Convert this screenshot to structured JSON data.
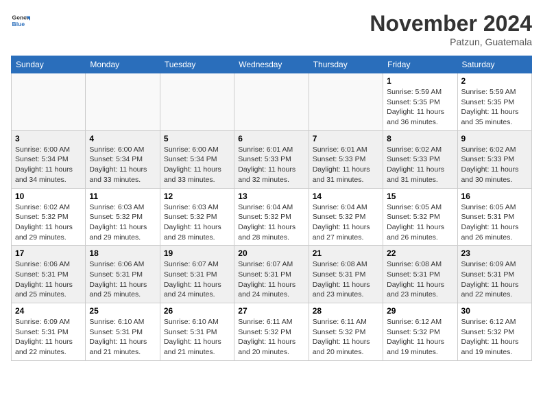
{
  "header": {
    "logo_general": "General",
    "logo_blue": "Blue",
    "month_title": "November 2024",
    "location": "Patzun, Guatemala"
  },
  "weekdays": [
    "Sunday",
    "Monday",
    "Tuesday",
    "Wednesday",
    "Thursday",
    "Friday",
    "Saturday"
  ],
  "weeks": [
    [
      {
        "day": "",
        "info": ""
      },
      {
        "day": "",
        "info": ""
      },
      {
        "day": "",
        "info": ""
      },
      {
        "day": "",
        "info": ""
      },
      {
        "day": "",
        "info": ""
      },
      {
        "day": "1",
        "info": "Sunrise: 5:59 AM\nSunset: 5:35 PM\nDaylight: 11 hours\nand 36 minutes."
      },
      {
        "day": "2",
        "info": "Sunrise: 5:59 AM\nSunset: 5:35 PM\nDaylight: 11 hours\nand 35 minutes."
      }
    ],
    [
      {
        "day": "3",
        "info": "Sunrise: 6:00 AM\nSunset: 5:34 PM\nDaylight: 11 hours\nand 34 minutes."
      },
      {
        "day": "4",
        "info": "Sunrise: 6:00 AM\nSunset: 5:34 PM\nDaylight: 11 hours\nand 33 minutes."
      },
      {
        "day": "5",
        "info": "Sunrise: 6:00 AM\nSunset: 5:34 PM\nDaylight: 11 hours\nand 33 minutes."
      },
      {
        "day": "6",
        "info": "Sunrise: 6:01 AM\nSunset: 5:33 PM\nDaylight: 11 hours\nand 32 minutes."
      },
      {
        "day": "7",
        "info": "Sunrise: 6:01 AM\nSunset: 5:33 PM\nDaylight: 11 hours\nand 31 minutes."
      },
      {
        "day": "8",
        "info": "Sunrise: 6:02 AM\nSunset: 5:33 PM\nDaylight: 11 hours\nand 31 minutes."
      },
      {
        "day": "9",
        "info": "Sunrise: 6:02 AM\nSunset: 5:33 PM\nDaylight: 11 hours\nand 30 minutes."
      }
    ],
    [
      {
        "day": "10",
        "info": "Sunrise: 6:02 AM\nSunset: 5:32 PM\nDaylight: 11 hours\nand 29 minutes."
      },
      {
        "day": "11",
        "info": "Sunrise: 6:03 AM\nSunset: 5:32 PM\nDaylight: 11 hours\nand 29 minutes."
      },
      {
        "day": "12",
        "info": "Sunrise: 6:03 AM\nSunset: 5:32 PM\nDaylight: 11 hours\nand 28 minutes."
      },
      {
        "day": "13",
        "info": "Sunrise: 6:04 AM\nSunset: 5:32 PM\nDaylight: 11 hours\nand 28 minutes."
      },
      {
        "day": "14",
        "info": "Sunrise: 6:04 AM\nSunset: 5:32 PM\nDaylight: 11 hours\nand 27 minutes."
      },
      {
        "day": "15",
        "info": "Sunrise: 6:05 AM\nSunset: 5:32 PM\nDaylight: 11 hours\nand 26 minutes."
      },
      {
        "day": "16",
        "info": "Sunrise: 6:05 AM\nSunset: 5:31 PM\nDaylight: 11 hours\nand 26 minutes."
      }
    ],
    [
      {
        "day": "17",
        "info": "Sunrise: 6:06 AM\nSunset: 5:31 PM\nDaylight: 11 hours\nand 25 minutes."
      },
      {
        "day": "18",
        "info": "Sunrise: 6:06 AM\nSunset: 5:31 PM\nDaylight: 11 hours\nand 25 minutes."
      },
      {
        "day": "19",
        "info": "Sunrise: 6:07 AM\nSunset: 5:31 PM\nDaylight: 11 hours\nand 24 minutes."
      },
      {
        "day": "20",
        "info": "Sunrise: 6:07 AM\nSunset: 5:31 PM\nDaylight: 11 hours\nand 24 minutes."
      },
      {
        "day": "21",
        "info": "Sunrise: 6:08 AM\nSunset: 5:31 PM\nDaylight: 11 hours\nand 23 minutes."
      },
      {
        "day": "22",
        "info": "Sunrise: 6:08 AM\nSunset: 5:31 PM\nDaylight: 11 hours\nand 23 minutes."
      },
      {
        "day": "23",
        "info": "Sunrise: 6:09 AM\nSunset: 5:31 PM\nDaylight: 11 hours\nand 22 minutes."
      }
    ],
    [
      {
        "day": "24",
        "info": "Sunrise: 6:09 AM\nSunset: 5:31 PM\nDaylight: 11 hours\nand 22 minutes."
      },
      {
        "day": "25",
        "info": "Sunrise: 6:10 AM\nSunset: 5:31 PM\nDaylight: 11 hours\nand 21 minutes."
      },
      {
        "day": "26",
        "info": "Sunrise: 6:10 AM\nSunset: 5:31 PM\nDaylight: 11 hours\nand 21 minutes."
      },
      {
        "day": "27",
        "info": "Sunrise: 6:11 AM\nSunset: 5:32 PM\nDaylight: 11 hours\nand 20 minutes."
      },
      {
        "day": "28",
        "info": "Sunrise: 6:11 AM\nSunset: 5:32 PM\nDaylight: 11 hours\nand 20 minutes."
      },
      {
        "day": "29",
        "info": "Sunrise: 6:12 AM\nSunset: 5:32 PM\nDaylight: 11 hours\nand 19 minutes."
      },
      {
        "day": "30",
        "info": "Sunrise: 6:12 AM\nSunset: 5:32 PM\nDaylight: 11 hours\nand 19 minutes."
      }
    ]
  ]
}
